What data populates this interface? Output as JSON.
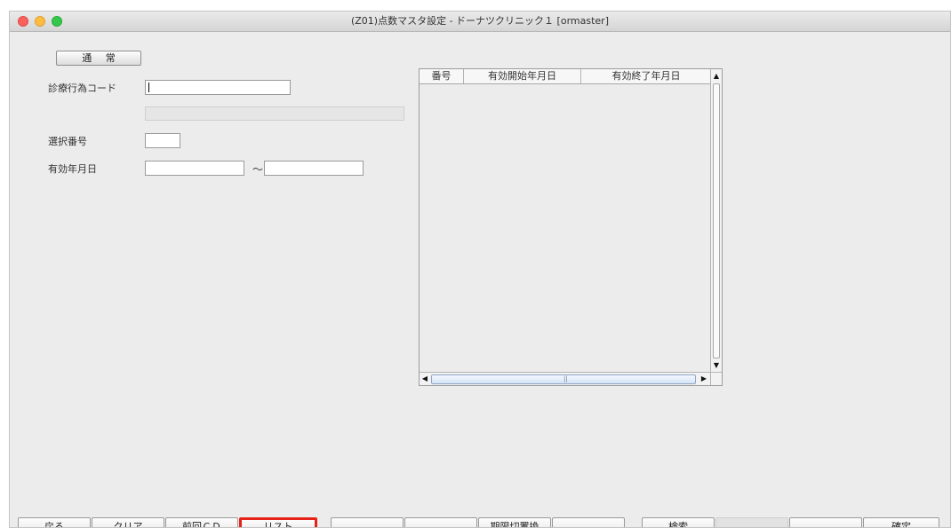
{
  "window": {
    "title": "(Z01)点数マスタ設定 - ドーナツクリニック１  [ormaster]"
  },
  "form": {
    "mode_button": "通 常",
    "shinryo_code_label": "診療行為コード",
    "shinryo_code_value": "",
    "name_value": "",
    "selection_no_label": "選択番号",
    "selection_no_value": "",
    "valid_date_label": "有効年月日",
    "valid_from": "",
    "tilde": "〜",
    "valid_to": ""
  },
  "table": {
    "headers": [
      "番号",
      "有効開始年月日",
      "有効終了年月日"
    ],
    "rows": []
  },
  "function_keys": [
    {
      "label": "戻る"
    },
    {
      "label": "クリア"
    },
    {
      "label": "前回ＣＤ"
    },
    {
      "label": "リスト",
      "highlighted": true
    },
    {
      "label": ""
    },
    {
      "label": ""
    },
    {
      "label": "期限切置換"
    },
    {
      "label": ""
    },
    {
      "label": "検索"
    },
    {
      "label": "",
      "disabled": true
    },
    {
      "label": ""
    },
    {
      "label": "確定"
    }
  ],
  "colors": {
    "highlight": "#e62117",
    "window_bg": "#ececec"
  }
}
